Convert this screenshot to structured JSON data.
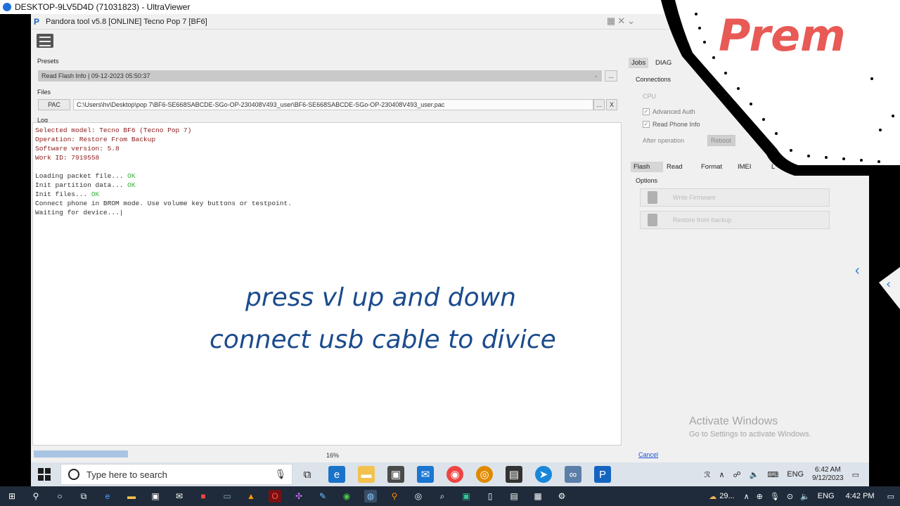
{
  "outer_window": {
    "title": "DESKTOP-9LV5D4D (71031823) - UltraViewer"
  },
  "app": {
    "title": "Pandora tool v5.8 [ONLINE] Tecno Pop 7 [BF6]",
    "presets_label": "Presets",
    "preset_value": "Read Flash Info | 09-12-2023 05:50:37",
    "files_label": "Files",
    "pac_button": "PAC",
    "file_path": "C:\\Users\\hv\\Desktop\\pop 7\\BF6-SE668SABCDE-SGo-OP-230408V493_user\\BF6-SE668SABCDE-SGo-OP-230408V493_user.pac",
    "browse_button": "...",
    "clear_button": "X",
    "log_label": "Log",
    "log": {
      "line1": "Selected model: Tecno BF6 (Tecno Pop 7)",
      "line2": "Operation: Restore From Backup",
      "line3": "Software version: 5.8",
      "line4": "Work ID: 7919558",
      "load_text": "Loading packet file... ",
      "init_part_text": "Init partition data... ",
      "init_files_text": "Init files... ",
      "ok": "OK",
      "connect_text": "Connect phone in BROM mode. Use volume key buttons or testpoint.",
      "waiting_text": "Waiting for device...|"
    },
    "overlay_line1": "press vl up and down",
    "overlay_line2": "connect usb cable to divice",
    "progress": {
      "percent_text": "16%",
      "fraction": 0.16
    },
    "cancel_link": "Cancel",
    "right_panel": {
      "tabs_top": [
        "Jobs",
        "DIAG"
      ],
      "connections_label": "Connections",
      "cpu_label": "CPU",
      "advanced_auth": "Advanced Auth",
      "read_phone_info": "Read Phone Info",
      "after_operation": "After operation",
      "after_value": "Reboot",
      "tabs_func": [
        "Flash",
        "Read",
        "Format",
        "IMEI",
        "L"
      ],
      "options_label": "Options",
      "write_firmware": "Write Firmware",
      "restore_backup": "Restore from backup"
    },
    "watermark_line1": "Activate Windows",
    "watermark_line2": "Go to Settings to activate Windows.",
    "badge_text": "Prem"
  },
  "remote_taskbar": {
    "search_placeholder": "Type here to search",
    "lang": "ENG",
    "time": "6:42 AM",
    "date": "9/12/2023"
  },
  "local_taskbar": {
    "weather": "29...",
    "lang": "ENG",
    "time": "4:42 PM"
  }
}
